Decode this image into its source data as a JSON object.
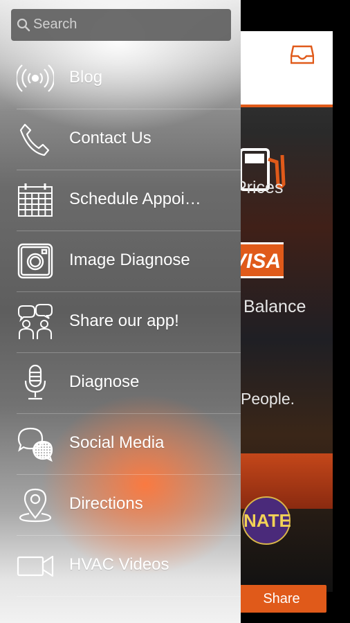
{
  "search": {
    "placeholder": "Search"
  },
  "menu": {
    "items": [
      {
        "label": "Blog",
        "icon": "broadcast-icon"
      },
      {
        "label": "Contact Us",
        "icon": "phone-icon"
      },
      {
        "label": "Schedule Appoi…",
        "icon": "calendar-icon"
      },
      {
        "label": "Image Diagnose",
        "icon": "camera-icon"
      },
      {
        "label": "Share our app!",
        "icon": "people-share-icon"
      },
      {
        "label": "Diagnose",
        "icon": "microphone-icon"
      },
      {
        "label": "Social Media",
        "icon": "chat-bubbles-icon"
      },
      {
        "label": "Directions",
        "icon": "map-pin-icon"
      },
      {
        "label": "HVAC Videos",
        "icon": "video-camera-icon"
      }
    ]
  },
  "background_app": {
    "texts": [
      "Prices",
      "Balance",
      "People."
    ],
    "card_brand": "VISA",
    "badge": "NATE",
    "share_button": "Share",
    "accent_color": "#e05a1a"
  }
}
